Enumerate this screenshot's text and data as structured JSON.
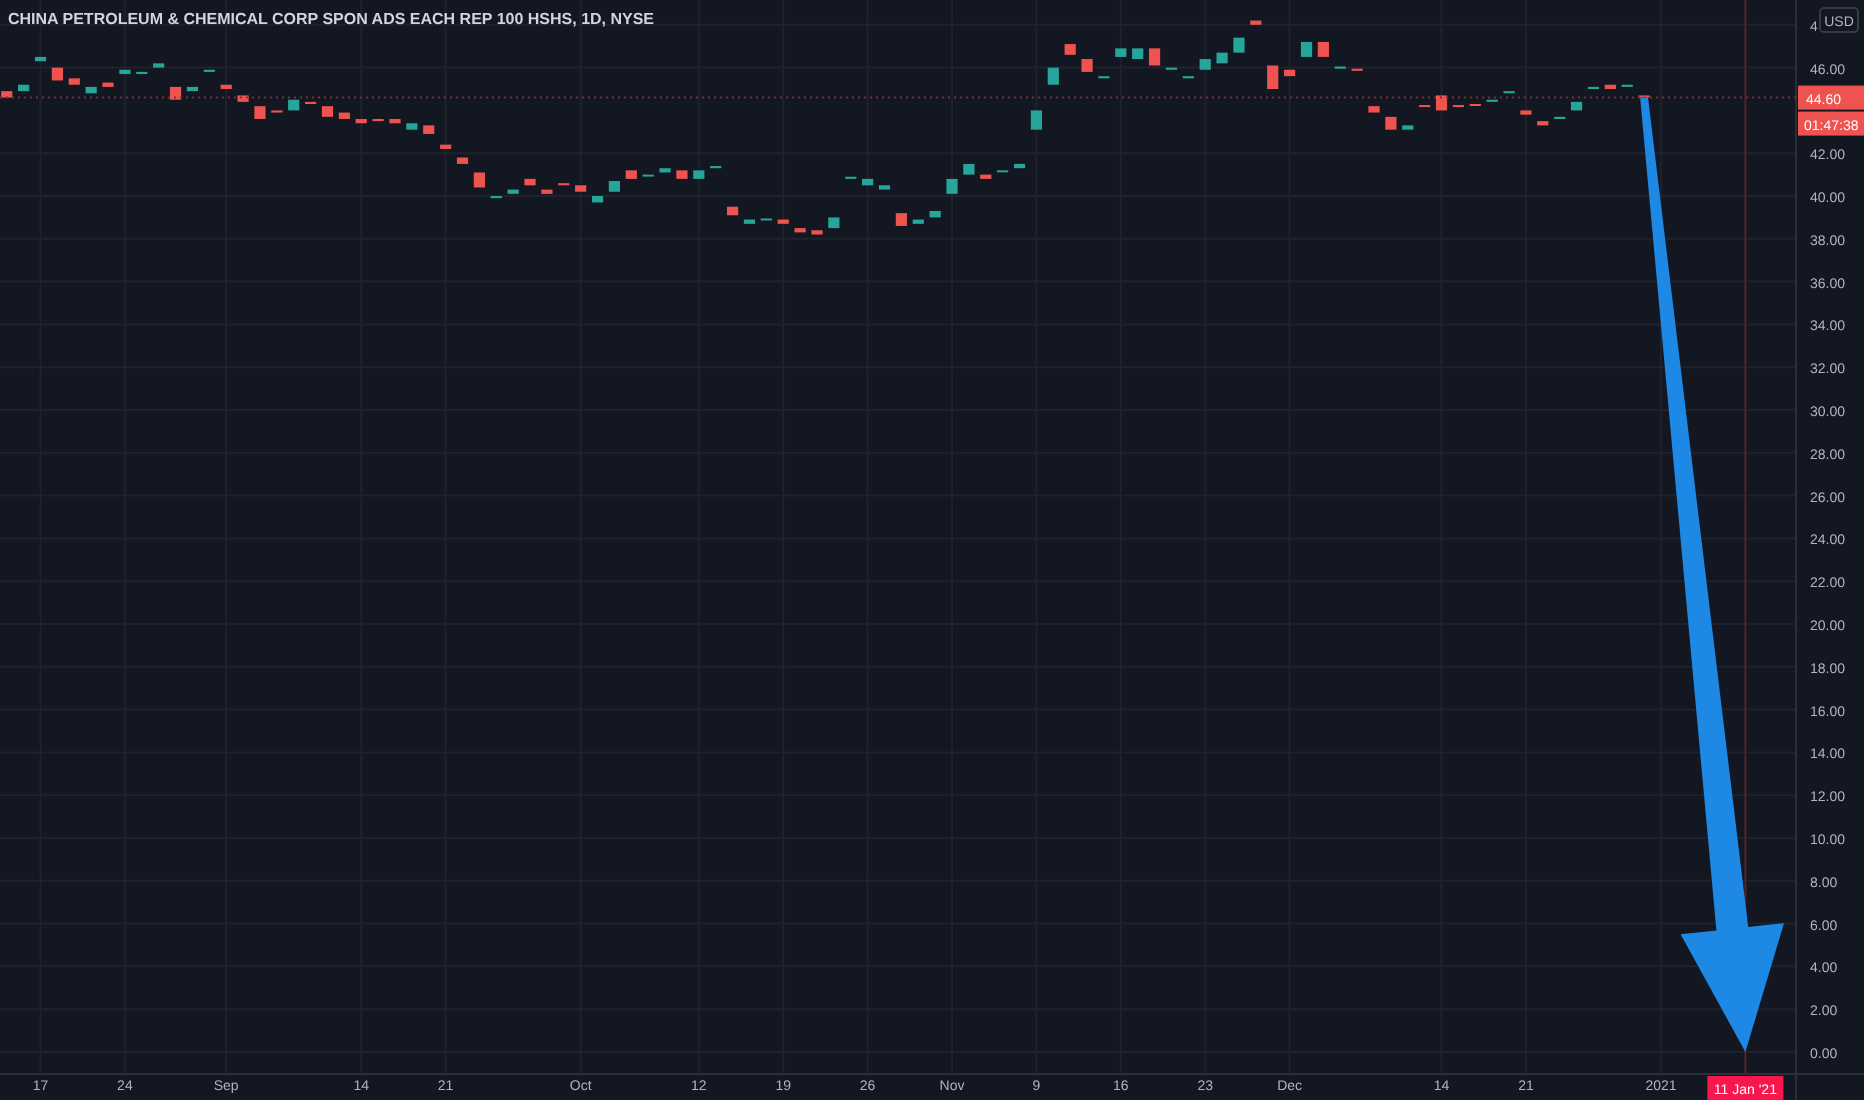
{
  "chart": {
    "title": "CHINA PETROLEUM & CHEMICAL CORP SPON ADS EACH REP 100 HSHS, 1D, NYSE",
    "currency": "USD",
    "price_axis": {
      "labels": [
        "4",
        "46.00",
        "42.00",
        "40.00",
        "38.00",
        "36.00",
        "34.00",
        "32.00",
        "30.00",
        "28.00",
        "26.00",
        "24.00",
        "22.00",
        "20.00",
        "18.00",
        "16.00",
        "14.00",
        "12.00",
        "10.00",
        "8.00",
        "6.00",
        "4.00",
        "2.00",
        "0.00"
      ]
    },
    "time_axis": {
      "labels": [
        "17",
        "24",
        "Sep",
        "14",
        "21",
        "Oct",
        "12",
        "19",
        "26",
        "Nov",
        "9",
        "16",
        "23",
        "Dec",
        "14",
        "21",
        "2021"
      ]
    },
    "last_price": "44.60",
    "countdown": "01:47:38",
    "date_marker": "11 Jan '21"
  }
}
